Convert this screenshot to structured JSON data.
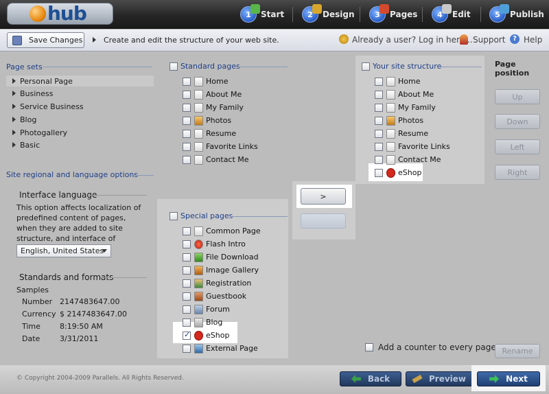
{
  "app": {
    "logo_text": "hub"
  },
  "steps": [
    {
      "num": "1",
      "label": "Start"
    },
    {
      "num": "2",
      "label": "Design"
    },
    {
      "num": "3",
      "label": "Pages"
    },
    {
      "num": "4",
      "label": "Edit"
    },
    {
      "num": "5",
      "label": "Publish"
    }
  ],
  "toolbar": {
    "save_label": "Save Changes",
    "hint": "Create and edit the structure of your web site.",
    "login_link": "Already a user? Log in here...",
    "support_label": "Support",
    "help_label": "Help"
  },
  "page_sets": {
    "title": "Page sets",
    "items": [
      "Personal Page",
      "Business",
      "Service Business",
      "Blog",
      "Photogallery",
      "Basic"
    ]
  },
  "regional": {
    "title": "Site regional and language options",
    "interface_language_title": "Interface language",
    "description": "This option affects localization of predefined content of pages, when they are added to site structure, and interface of modules.",
    "language_selected": "English, United States",
    "standards_title": "Standards and formats",
    "samples_label": "Samples",
    "samples": [
      {
        "label": "Number",
        "value": "2147483647.00"
      },
      {
        "label": "Currency",
        "value": "$ 2147483647.00"
      },
      {
        "label": "Time",
        "value": "8:19:50 AM"
      },
      {
        "label": "Date",
        "value": "3/31/2011"
      }
    ]
  },
  "standard_pages": {
    "title": "Standard pages",
    "items": [
      "Home",
      "About Me",
      "My Family",
      "Photos",
      "Resume",
      "Favorite Links",
      "Contact Me"
    ]
  },
  "special_pages": {
    "title": "Special pages",
    "items": [
      "Common Page",
      "Flash Intro",
      "File Download",
      "Image Gallery",
      "Registration",
      "Guestbook",
      "Forum",
      "Blog",
      "eShop",
      "External Page"
    ],
    "checked": "eShop"
  },
  "site_structure": {
    "title": "Your site structure",
    "items": [
      "Home",
      "About Me",
      "My Family",
      "Photos",
      "Resume",
      "Favorite Links",
      "Contact Me",
      "eShop"
    ]
  },
  "transfer": {
    "add_label": ">",
    "remove_label": "<"
  },
  "page_position": {
    "title": "Page position",
    "buttons": [
      "Up",
      "Down",
      "Left",
      "Right"
    ],
    "rename_label": "Rename"
  },
  "counter": {
    "label": "Add a counter to every page"
  },
  "footer": {
    "copyright": "© Copyright 2004-2009 Parallels. All Rights Reserved.",
    "back_label": "Back",
    "preview_label": "Preview",
    "next_label": "Next"
  },
  "colors": {
    "accent_blue": "#1f3f88",
    "toolbar_bg": "#262626",
    "highlight": "#ffffff"
  }
}
